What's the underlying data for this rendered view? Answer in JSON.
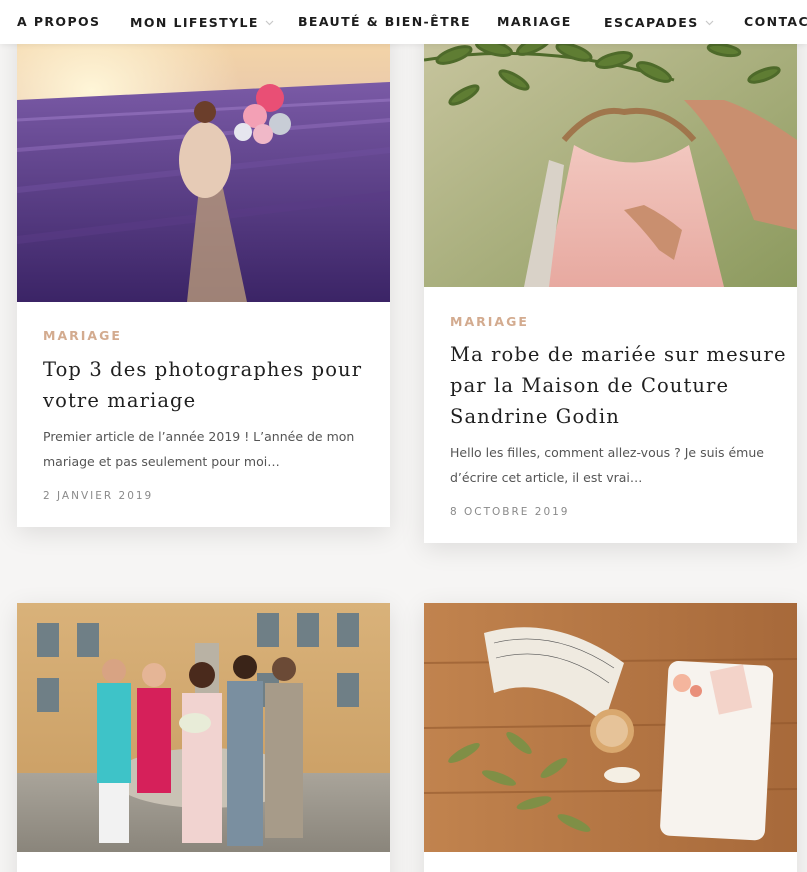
{
  "nav": {
    "items": [
      {
        "label": "A PROPOS",
        "has_dropdown": false
      },
      {
        "label": "MON LIFESTYLE",
        "has_dropdown": true
      },
      {
        "label": "BEAUTÉ & BIEN-ÊTRE",
        "has_dropdown": false
      },
      {
        "label": "MARIAGE",
        "has_dropdown": false
      },
      {
        "label": "ESCAPADES",
        "has_dropdown": true
      },
      {
        "label": "CONTACT",
        "has_dropdown": false
      }
    ],
    "chevron_icon": "chevron-down-icon"
  },
  "posts": [
    {
      "category": "MARIAGE",
      "title_lines": [
        "Top 3 des photographes pour",
        "votre mariage"
      ],
      "excerpt_lines": [
        "Premier article de l’année 2019 ! L’année de mon",
        "mariage et pas seulement pour moi…"
      ],
      "date": "2 JANVIER 2019"
    },
    {
      "category": "MARIAGE",
      "title_lines": [
        "Ma robe de mariée sur mesure",
        "par la Maison de Couture",
        "Sandrine Godin"
      ],
      "excerpt_lines": [
        "Hello les filles, comment allez-vous ? Je suis émue",
        "d’écrire cet article, il est vrai…"
      ],
      "date": "8 OCTOBRE 2019"
    },
    {},
    {}
  ],
  "colors": {
    "accent": "#d3ab8f",
    "text": "#1f1f1f",
    "muted": "#8a8a8a",
    "background": "#f6f5f4"
  }
}
